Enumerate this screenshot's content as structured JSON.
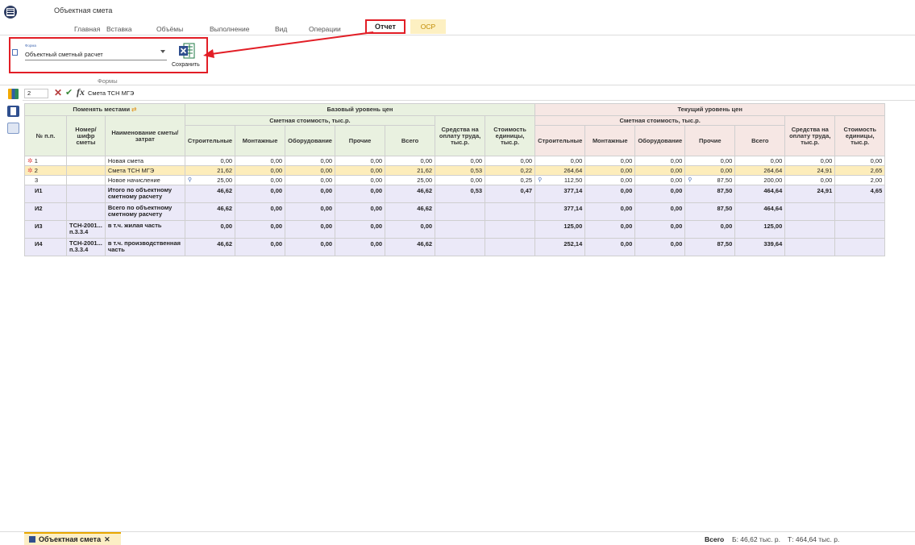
{
  "app": {
    "title": "Объектная смета"
  },
  "tabs": [
    "Главная",
    "Вставка",
    "Объёмы",
    "Выполнение",
    "Вид",
    "Операции",
    "Отчет",
    "ОСР"
  ],
  "forms": {
    "field_label": "Форма",
    "selected_form": "Объектный сметный расчет",
    "save_label": "Сохранить",
    "group_label": "Формы"
  },
  "formula_bar": {
    "row_number": "2",
    "fx_label": "fx",
    "value": "Смета ТСН МГЭ"
  },
  "table": {
    "swap_label": "Поменять местами",
    "base_group": "Базовый уровень цен",
    "current_group": "Текущий уровень цен",
    "cost_group": "Сметная стоимость, тыс.р.",
    "col_num": "№ п.п.",
    "col_code": "Номер/шифр сметы",
    "col_name": "Наименование сметы/ затрат",
    "col_build": "Строительные",
    "col_mount": "Монтажные",
    "col_equip": "Оборудование",
    "col_other": "Прочие",
    "col_total": "Всего",
    "col_labor": "Средства на оплату труда, тыс.р.",
    "col_unit": "Стоимость единицы, тыс.р.",
    "rows": [
      {
        "num": "1",
        "code": "",
        "name": "Новая смета",
        "b": [
          "0,00",
          "0,00",
          "0,00",
          "0,00",
          "0,00",
          "0,00",
          "0,00"
        ],
        "c": [
          "0,00",
          "0,00",
          "0,00",
          "0,00",
          "0,00",
          "0,00",
          "0,00"
        ]
      },
      {
        "num": "2",
        "code": "",
        "name": "Смета ТСН МГЭ",
        "b": [
          "21,62",
          "0,00",
          "0,00",
          "0,00",
          "21,62",
          "0,53",
          "0,22"
        ],
        "c": [
          "264,64",
          "0,00",
          "0,00",
          "0,00",
          "264,64",
          "24,91",
          "2,65"
        ]
      },
      {
        "num": "3",
        "code": "",
        "name": "Новое начисление",
        "b": [
          "25,00",
          "0,00",
          "0,00",
          "0,00",
          "25,00",
          "0,00",
          "0,25"
        ],
        "c": [
          "112,50",
          "0,00",
          "0,00",
          "87,50",
          "200,00",
          "0,00",
          "2,00"
        ]
      },
      {
        "num": "И1",
        "code": "",
        "name": "Итого по объектному сметному расчету",
        "b": [
          "46,62",
          "0,00",
          "0,00",
          "0,00",
          "46,62",
          "0,53",
          "0,47"
        ],
        "c": [
          "377,14",
          "0,00",
          "0,00",
          "87,50",
          "464,64",
          "24,91",
          "4,65"
        ]
      },
      {
        "num": "И2",
        "code": "",
        "name": "Всего по объектному сметному расчету",
        "b": [
          "46,62",
          "0,00",
          "0,00",
          "0,00",
          "46,62",
          "",
          ""
        ],
        "c": [
          "377,14",
          "0,00",
          "0,00",
          "87,50",
          "464,64",
          "",
          ""
        ]
      },
      {
        "num": "И3",
        "code": "ТСН-2001... п.3.3.4",
        "name": "в т.ч. жилая часть",
        "b": [
          "0,00",
          "0,00",
          "0,00",
          "0,00",
          "0,00",
          "",
          ""
        ],
        "c": [
          "125,00",
          "0,00",
          "0,00",
          "0,00",
          "125,00",
          "",
          ""
        ]
      },
      {
        "num": "И4",
        "code": "ТСН-2001... п.3.3.4",
        "name": "в т.ч. производственная часть",
        "b": [
          "46,62",
          "0,00",
          "0,00",
          "0,00",
          "46,62",
          "",
          ""
        ],
        "c": [
          "252,14",
          "0,00",
          "0,00",
          "87,50",
          "339,64",
          "",
          ""
        ]
      }
    ]
  },
  "bottom": {
    "doc_tab": "Объектная смета",
    "total_label": "Всего",
    "total_base": "Б: 46,62 тыс. р.",
    "total_current": "Т: 464,64 тыс. р."
  },
  "colors": {
    "accent_red": "#e21e26",
    "excel_green": "#1f7a44",
    "header_green": "#e9f1e0",
    "header_red": "#f6e7e4",
    "row_yellow": "#fdedbb",
    "row_purple": "#ebe9f8"
  },
  "icons": [
    "app-logo-icon",
    "document-icon",
    "excel-icon",
    "pin-icon",
    "star-icon",
    "close-icon",
    "check-icon",
    "swap-icon"
  ]
}
